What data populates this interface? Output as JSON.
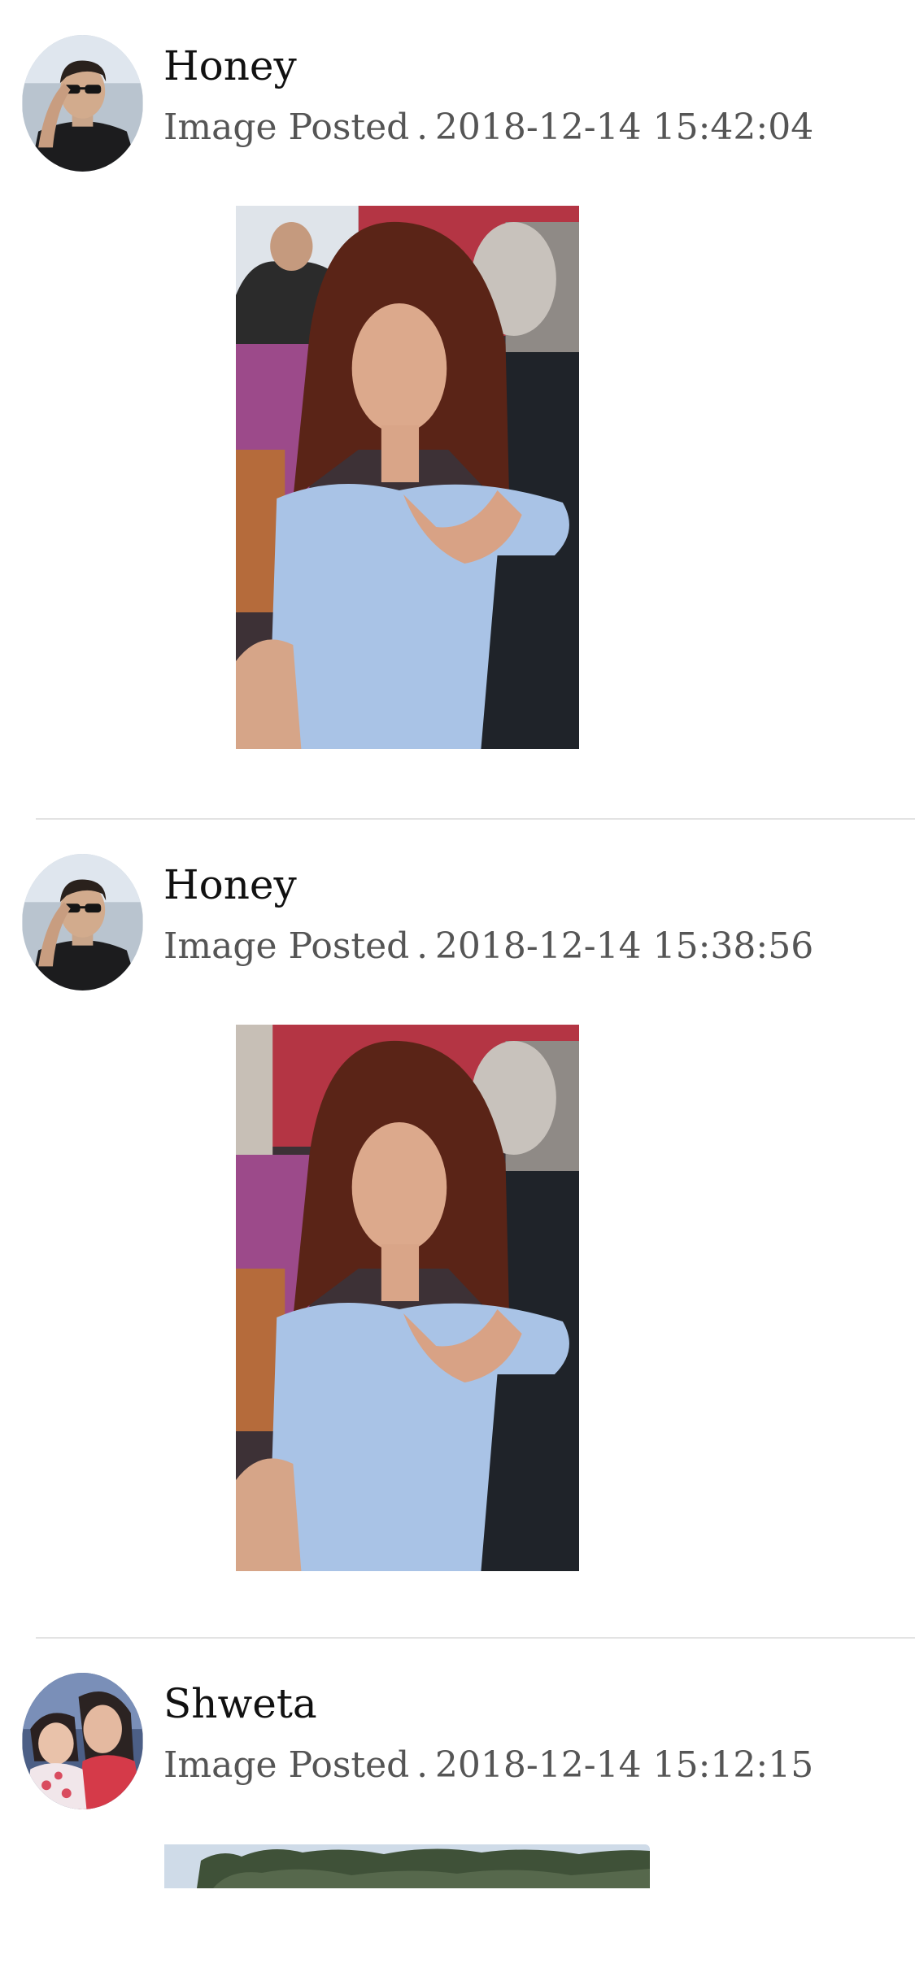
{
  "feed": {
    "posts": [
      {
        "user": "Honey",
        "action": "Image Posted",
        "separator": ".",
        "timestamp": "2018-12-14 15:42:04",
        "avatar_icon": "user-avatar-man-sunglasses",
        "image": "photo-woman-blue-dress"
      },
      {
        "user": "Honey",
        "action": "Image Posted",
        "separator": ".",
        "timestamp": "2018-12-14 15:38:56",
        "avatar_icon": "user-avatar-man-sunglasses",
        "image": "photo-woman-blue-dress"
      },
      {
        "user": "Shweta",
        "action": "Image Posted",
        "separator": ".",
        "timestamp": "2018-12-14 15:12:15",
        "avatar_icon": "user-avatar-woman-child",
        "image": "photo-trees-sky"
      }
    ]
  },
  "colors": {
    "background": "#ffffff",
    "name_text": "#111111",
    "meta_text": "#555555",
    "divider": "#e3e3e3",
    "dress_blue": "#a9c3e6"
  }
}
